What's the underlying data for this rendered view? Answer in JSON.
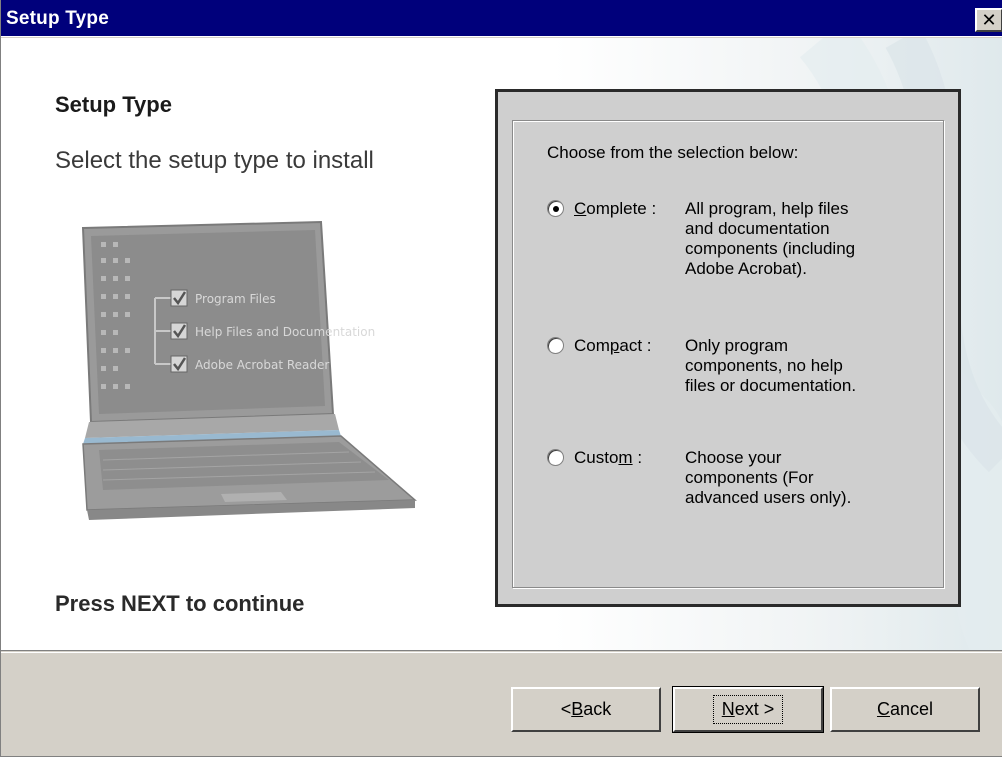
{
  "window": {
    "title": "Setup Type",
    "close_glyph": "✕"
  },
  "page": {
    "heading": "Setup Type",
    "subheading": "Select the setup type to install",
    "footer_prompt": "Press NEXT to continue"
  },
  "illustration": {
    "checklist": [
      {
        "label": "Program Files",
        "checked": true
      },
      {
        "label": "Help Files and Documentation",
        "checked": true
      },
      {
        "label": "Adobe Acrobat Reader",
        "checked": true
      }
    ]
  },
  "options": {
    "prompt": "Choose from the selection below:",
    "items": [
      {
        "label_pre": "",
        "accel": "C",
        "label_post": "omplete :",
        "checked": true,
        "desc_lines": [
          "All program, help files",
          "and documentation",
          "components (including",
          "Adobe Acrobat)."
        ]
      },
      {
        "label_pre": "Com",
        "accel": "p",
        "label_post": "act :",
        "checked": false,
        "desc_lines": [
          "Only program",
          "components, no help",
          "files or documentation."
        ]
      },
      {
        "label_pre": "Custo",
        "accel": "m",
        "label_post": " :",
        "checked": false,
        "desc_lines": [
          "Choose your",
          "components (For",
          "advanced users only)."
        ]
      }
    ]
  },
  "buttons": {
    "back": {
      "pre": "< ",
      "accel": "B",
      "post": "ack"
    },
    "next": {
      "pre": "",
      "accel": "N",
      "post": "ext >"
    },
    "cancel": {
      "pre": "",
      "accel": "C",
      "post": "ancel"
    }
  }
}
